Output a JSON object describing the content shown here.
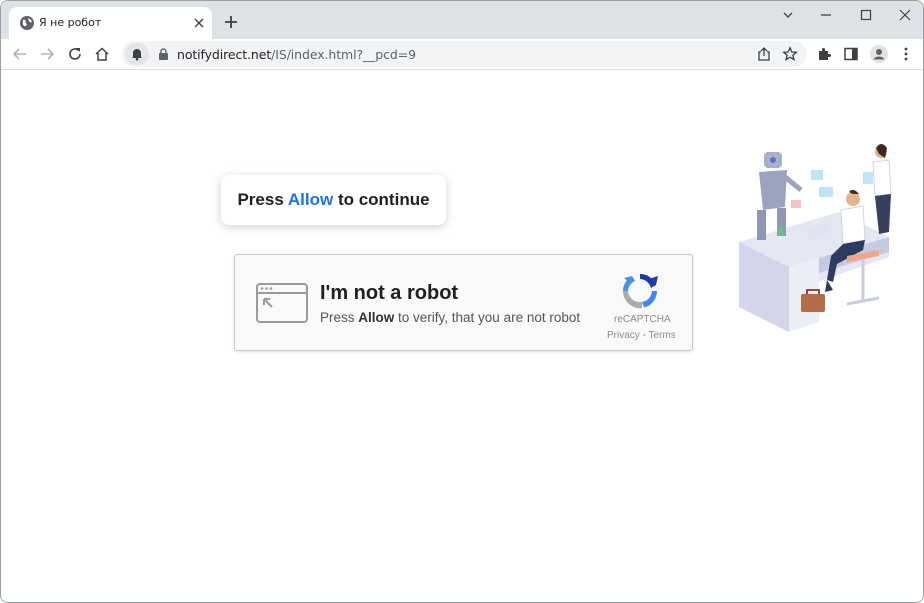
{
  "browser": {
    "tab_title": "Я не робот",
    "url_domain": "notifydirect.net",
    "url_path": "/IS/index.html?__pcd=9"
  },
  "page": {
    "prompt_before": "Press ",
    "prompt_allow": "Allow",
    "prompt_after": " to continue",
    "captcha_heading": "I'm not a robot",
    "captcha_sub_before": "Press ",
    "captcha_sub_allow": "Allow",
    "captcha_sub_after": " to verify, that you are not robot",
    "recaptcha_label": "reCAPTCHA",
    "privacy_link": "Privacy",
    "link_separator": " - ",
    "terms_link": "Terms"
  },
  "colors": {
    "accent": "#1a73e8",
    "tabstrip": "#dee1e6",
    "recaptcha_blue": "#4a90e2"
  },
  "icons": [
    "globe-icon",
    "close-icon",
    "plus-icon",
    "chevron-down-icon",
    "minimize-icon",
    "maximize-icon",
    "close-window-icon",
    "back-icon",
    "forward-icon",
    "reload-icon",
    "home-icon",
    "bell-icon",
    "lock-icon",
    "share-icon",
    "star-icon",
    "extensions-icon",
    "side-panel-icon",
    "profile-icon",
    "menu-icon",
    "browser-window-icon",
    "recaptcha-logo-icon"
  ]
}
